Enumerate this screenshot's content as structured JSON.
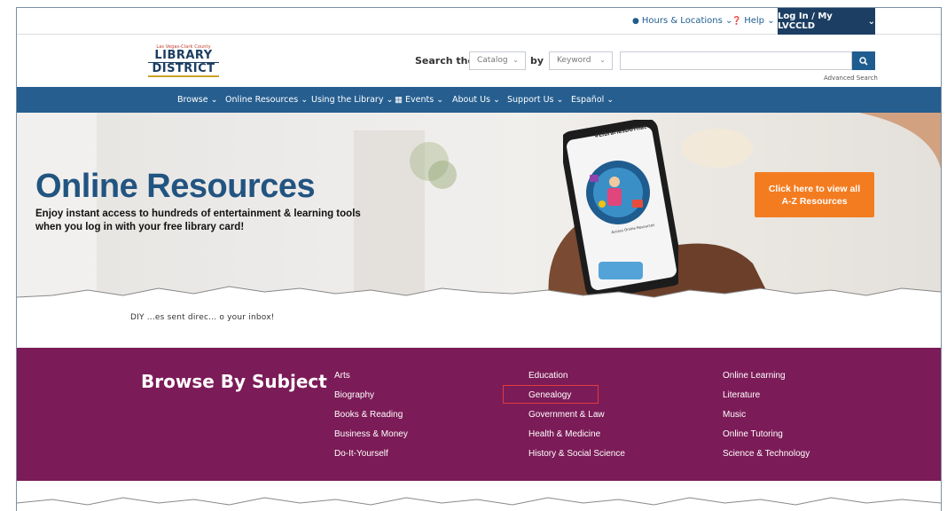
{
  "utility": {
    "hours": "Hours & Locations",
    "help": "Help",
    "login": "Log In / My LVCCLD"
  },
  "logo": {
    "small": "Las Vegas-Clark County",
    "line1": "LIBRARY",
    "line2": "DISTRICT"
  },
  "search": {
    "label": "Search the",
    "catalog": "Catalog",
    "by": "by",
    "keyword": "Keyword",
    "input_value": "",
    "advanced": "Advanced Search"
  },
  "nav": {
    "items": [
      "Browse",
      "Online Resources",
      "Using the Library",
      "Events",
      "About Us",
      "Support Us",
      "Español"
    ]
  },
  "hero": {
    "title": "Online Resources",
    "sub1": "Enjoy instant access to hundreds of entertainment & learning tools",
    "sub2": "when you log in with your free library card!",
    "az_line1": "Click here to view all",
    "az_line2": "A-Z Resources",
    "phone_tag": "#LibrariesDoThat",
    "phone_caption": "Access Online Resources"
  },
  "partial_text": "DIY ...es sent direc... o your inbox!",
  "browse": {
    "title": "Browse By Subject",
    "col1": [
      "Arts",
      "Biography",
      "Books & Reading",
      "Business & Money",
      "Do-It-Yourself"
    ],
    "col2": [
      "Education",
      "Genealogy",
      "Government & Law",
      "Health & Medicine",
      "History & Social Science"
    ],
    "col3": [
      "Online Learning",
      "Literature",
      "Music",
      "Online Tutoring",
      "Science & Technology"
    ]
  },
  "colors": {
    "nav": "#255e8f",
    "brand_dark": "#1c3e62",
    "accent_orange": "#f47c20",
    "browse_bg": "#7b1b57",
    "highlight": "#e23b3b"
  }
}
